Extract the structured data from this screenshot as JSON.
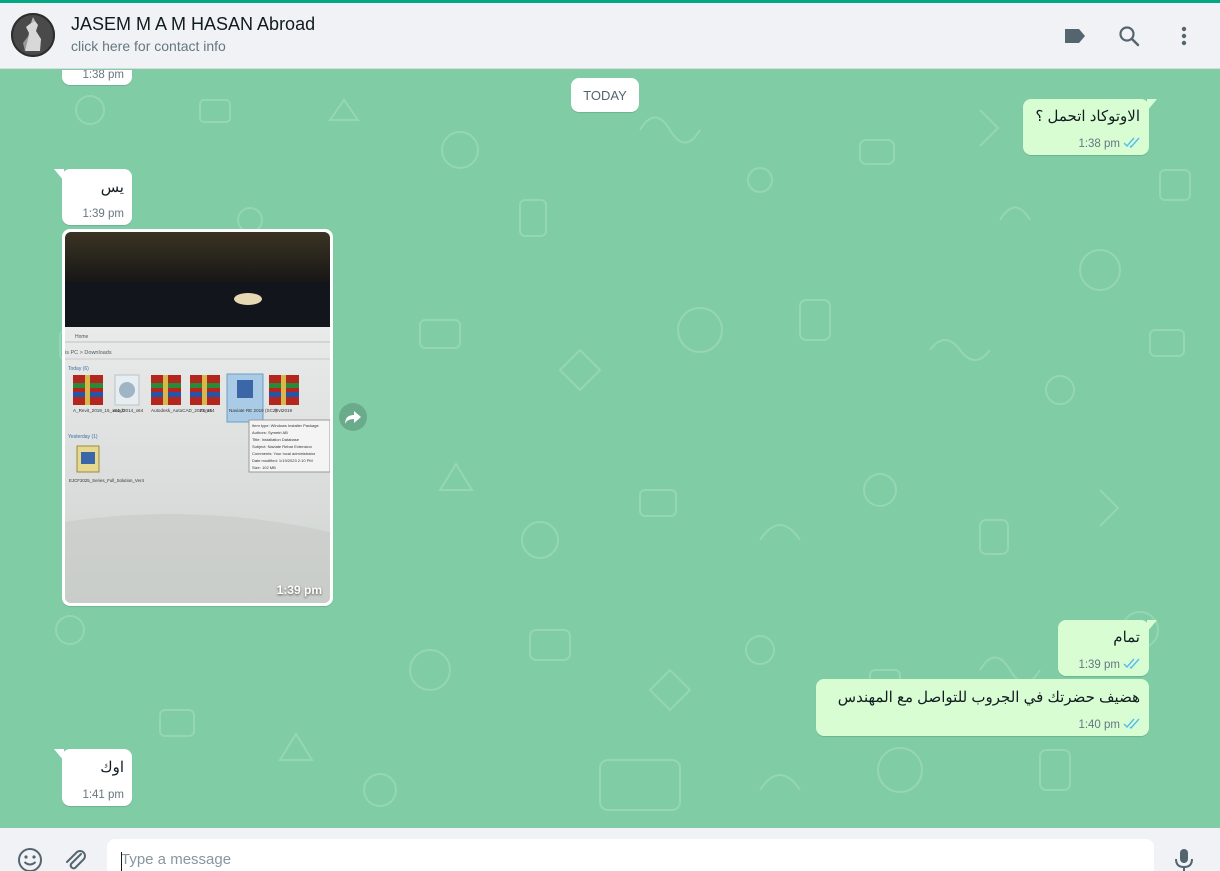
{
  "colors": {
    "accent": "#00a884",
    "chat_background": "#7fcca5",
    "outgoing_bubble": "#d9fdd3",
    "incoming_bubble": "#ffffff",
    "read_ticks": "#53bdeb"
  },
  "header": {
    "contact_name": "JASEM M A M HASAN Abroad",
    "contact_subtitle": "click here for contact info",
    "icons": [
      "label-icon",
      "search-icon",
      "menu-icon"
    ]
  },
  "chat": {
    "date_divider": "TODAY",
    "messages": [
      {
        "direction": "in",
        "text": "",
        "time": "1:38 pm"
      },
      {
        "direction": "out",
        "text": "الاوتوكاد اتحمل ؟",
        "time": "1:38 pm",
        "status": "read"
      },
      {
        "direction": "in",
        "text": "يس",
        "time": "1:39 pm"
      },
      {
        "direction": "in",
        "type": "image",
        "time": "1:39 pm"
      },
      {
        "direction": "out",
        "text": "تمام",
        "time": "1:39 pm",
        "status": "read"
      },
      {
        "direction": "out",
        "text": "هضيف حضرتك في الجروب للتواصل مع المهندس",
        "time": "1:40 pm",
        "status": "read"
      },
      {
        "direction": "in",
        "text": "اوك",
        "time": "1:41 pm"
      }
    ]
  },
  "photo": {
    "breadcrumb": "is PC > Downloads",
    "group_today": "Today (6)",
    "group_yesterday": "Yesterday (1)",
    "files": [
      "A_Revit_2019_15_x64_0",
      "acad2014_x64",
      "Autodesk_AutoCAD_2022_x64",
      "Fonts",
      "Naviate RE 2019 (SC2)",
      "Rvt2019"
    ],
    "yesterday_file": "EJCF2025_Series_Full_Solution_Ver4",
    "tooltip": [
      "Item type: Windows Installer Package",
      "Authors: Symetri AB",
      "Title: Installation Database",
      "Subject: Naviate Rebar Extension",
      "Comments: Your local administrator",
      "Date modified: 1/19/2023 2:10 PM",
      "Size: 102 MB"
    ]
  },
  "footer": {
    "placeholder": "Type a message",
    "icons": [
      "emoji-icon",
      "attach-icon",
      "microphone-icon"
    ]
  }
}
